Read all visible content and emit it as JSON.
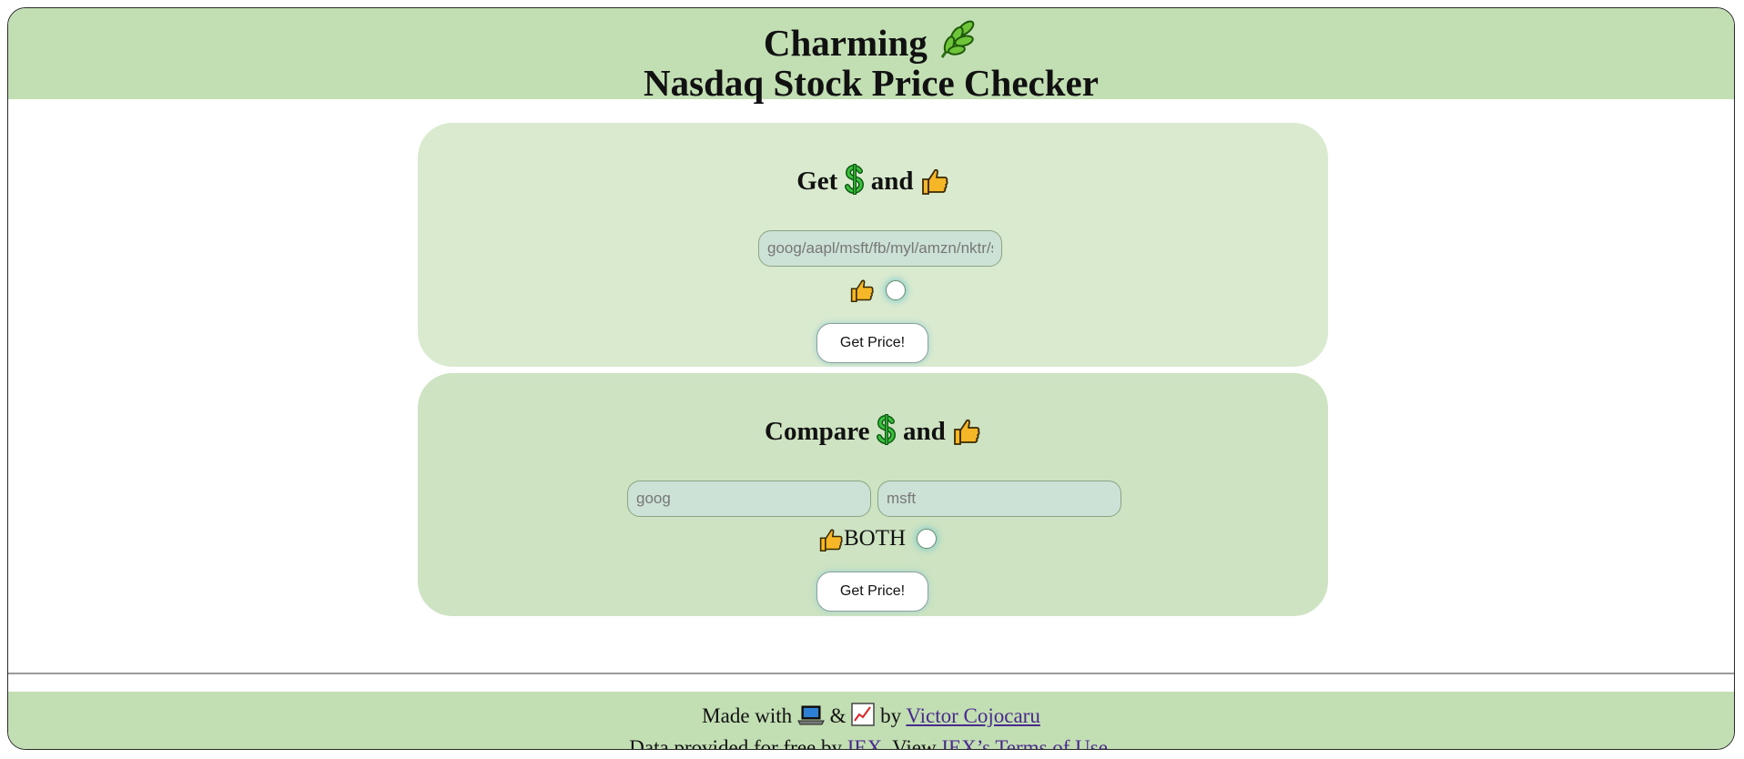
{
  "header": {
    "brand": "Charming",
    "title": "Nasdaq Stock Price Checker"
  },
  "single": {
    "heading_get": "Get",
    "heading_and": "and",
    "ticker_placeholder": "goog/aapl/msft/fb/myl/amzn/nktr/s",
    "submit_label": "Get Price!"
  },
  "compare": {
    "heading_compare": "Compare",
    "heading_and": "and",
    "ticker1_placeholder": "goog",
    "ticker2_placeholder": "msft",
    "like_both_label": "BOTH",
    "submit_label": "Get Price!"
  },
  "footer": {
    "made_with": "Made with",
    "amp": "&",
    "by": "by",
    "author_link": "Victor Cojocaru",
    "data_text": "Data provided for free by",
    "iex_link": "IEX",
    "view_text": ". View",
    "terms_link": "IEX’s Terms of Use",
    "end": "."
  },
  "icons": {
    "leaf": "herb-icon",
    "dollar": "dollar-icon",
    "like": "thumbs-up-icon",
    "laptop": "laptop-icon",
    "chart": "chart-increasing-icon"
  },
  "colors": {
    "header_bg": "#c2deb3",
    "panel1_bg": "#d9eacf",
    "panel2_bg": "#cde3c1",
    "link": "#4a2a8c"
  }
}
